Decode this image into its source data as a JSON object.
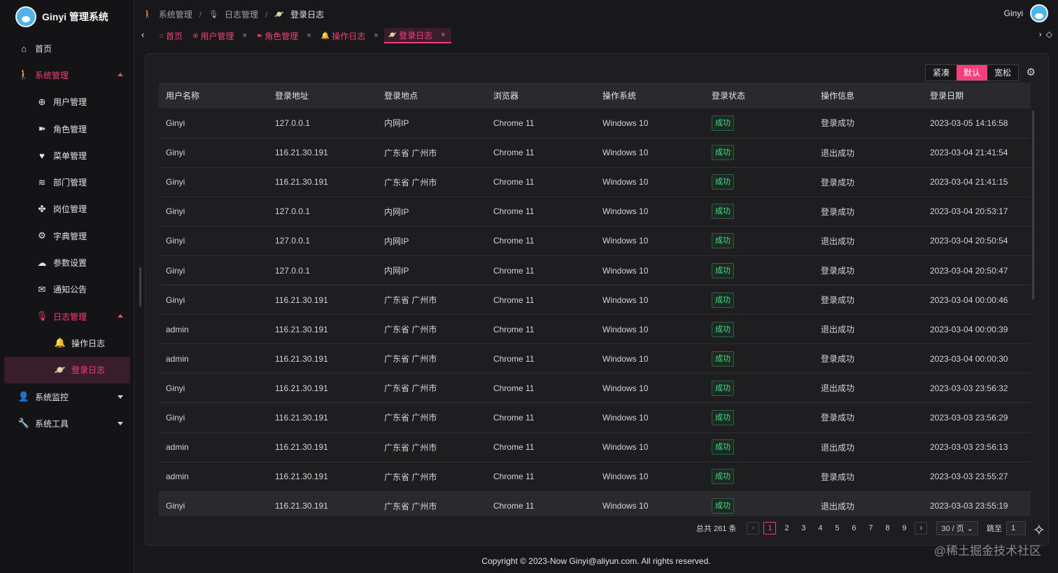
{
  "app": {
    "title": "Ginyi 管理系统"
  },
  "sidebar": {
    "items": [
      {
        "label": "首页",
        "icon": "home-icon",
        "glyph": "⌂"
      },
      {
        "label": "系统管理",
        "icon": "person-icon",
        "glyph": "🚶"
      },
      {
        "label": "用户管理",
        "icon": "user-add-icon",
        "glyph": "⊕"
      },
      {
        "label": "角色管理",
        "icon": "role-icon",
        "glyph": "➽"
      },
      {
        "label": "菜单管理",
        "icon": "heart-icon",
        "glyph": "♥"
      },
      {
        "label": "部门管理",
        "icon": "layers-icon",
        "glyph": "≋"
      },
      {
        "label": "岗位管理",
        "icon": "paw-icon",
        "glyph": "✤"
      },
      {
        "label": "字典管理",
        "icon": "gear-icon",
        "glyph": "⚙"
      },
      {
        "label": "参数设置",
        "icon": "chat-icon",
        "glyph": "☁"
      },
      {
        "label": "通知公告",
        "icon": "mail-icon",
        "glyph": "✉"
      },
      {
        "label": "日志管理",
        "icon": "mic-icon",
        "glyph": "🎙"
      },
      {
        "label": "操作日志",
        "icon": "bell-icon",
        "glyph": "🔔"
      },
      {
        "label": "登录日志",
        "icon": "planet-icon",
        "glyph": "🪐"
      },
      {
        "label": "系统监控",
        "icon": "user-icon",
        "glyph": "👤"
      },
      {
        "label": "系统工具",
        "icon": "wrench-icon",
        "glyph": "🔧"
      }
    ]
  },
  "header": {
    "breadcrumb": [
      "系统管理",
      "日志管理",
      "登录日志"
    ],
    "username": "Ginyi"
  },
  "tabs": [
    "首页",
    "用户管理",
    "角色管理",
    "操作日志",
    "登录日志"
  ],
  "toolbar": {
    "density": [
      "紧凑",
      "默认",
      "宽松"
    ]
  },
  "table": {
    "columns": [
      "用户名称",
      "登录地址",
      "登录地点",
      "浏览器",
      "操作系统",
      "登录状态",
      "操作信息",
      "登录日期"
    ],
    "rows": [
      [
        "Ginyi",
        "127.0.0.1",
        "内网IP",
        "Chrome 11",
        "Windows 10",
        "成功",
        "登录成功",
        "2023-03-05 14:16:58"
      ],
      [
        "Ginyi",
        "116.21.30.191",
        "广东省 广州市",
        "Chrome 11",
        "Windows 10",
        "成功",
        "退出成功",
        "2023-03-04 21:41:54"
      ],
      [
        "Ginyi",
        "116.21.30.191",
        "广东省 广州市",
        "Chrome 11",
        "Windows 10",
        "成功",
        "登录成功",
        "2023-03-04 21:41:15"
      ],
      [
        "Ginyi",
        "127.0.0.1",
        "内网IP",
        "Chrome 11",
        "Windows 10",
        "成功",
        "登录成功",
        "2023-03-04 20:53:17"
      ],
      [
        "Ginyi",
        "127.0.0.1",
        "内网IP",
        "Chrome 11",
        "Windows 10",
        "成功",
        "退出成功",
        "2023-03-04 20:50:54"
      ],
      [
        "Ginyi",
        "127.0.0.1",
        "内网IP",
        "Chrome 11",
        "Windows 10",
        "成功",
        "登录成功",
        "2023-03-04 20:50:47"
      ],
      [
        "Ginyi",
        "116.21.30.191",
        "广东省 广州市",
        "Chrome 11",
        "Windows 10",
        "成功",
        "登录成功",
        "2023-03-04 00:00:46"
      ],
      [
        "admin",
        "116.21.30.191",
        "广东省 广州市",
        "Chrome 11",
        "Windows 10",
        "成功",
        "退出成功",
        "2023-03-04 00:00:39"
      ],
      [
        "admin",
        "116.21.30.191",
        "广东省 广州市",
        "Chrome 11",
        "Windows 10",
        "成功",
        "登录成功",
        "2023-03-04 00:00:30"
      ],
      [
        "Ginyi",
        "116.21.30.191",
        "广东省 广州市",
        "Chrome 11",
        "Windows 10",
        "成功",
        "退出成功",
        "2023-03-03 23:56:32"
      ],
      [
        "Ginyi",
        "116.21.30.191",
        "广东省 广州市",
        "Chrome 11",
        "Windows 10",
        "成功",
        "登录成功",
        "2023-03-03 23:56:29"
      ],
      [
        "admin",
        "116.21.30.191",
        "广东省 广州市",
        "Chrome 11",
        "Windows 10",
        "成功",
        "退出成功",
        "2023-03-03 23:56:13"
      ],
      [
        "admin",
        "116.21.30.191",
        "广东省 广州市",
        "Chrome 11",
        "Windows 10",
        "成功",
        "登录成功",
        "2023-03-03 23:55:27"
      ],
      [
        "Ginyi",
        "116.21.30.191",
        "广东省 广州市",
        "Chrome 11",
        "Windows 10",
        "成功",
        "退出成功",
        "2023-03-03 23:55:19"
      ]
    ]
  },
  "pagination": {
    "total": "总共 261 条",
    "pages": [
      "1",
      "2",
      "3",
      "4",
      "5",
      "6",
      "7",
      "8",
      "9"
    ],
    "page_size": "30 / 页",
    "jump_label": "跳至",
    "jump_value": "1"
  },
  "footer": {
    "copyright": "Copyright © 2023-Now Ginyi@aliyun.com. All rights reserved."
  },
  "watermark": "@稀土掘金技术社区",
  "colors": {
    "accent": "#f43f7a",
    "success": "#4ade80",
    "background": "#18181b"
  }
}
